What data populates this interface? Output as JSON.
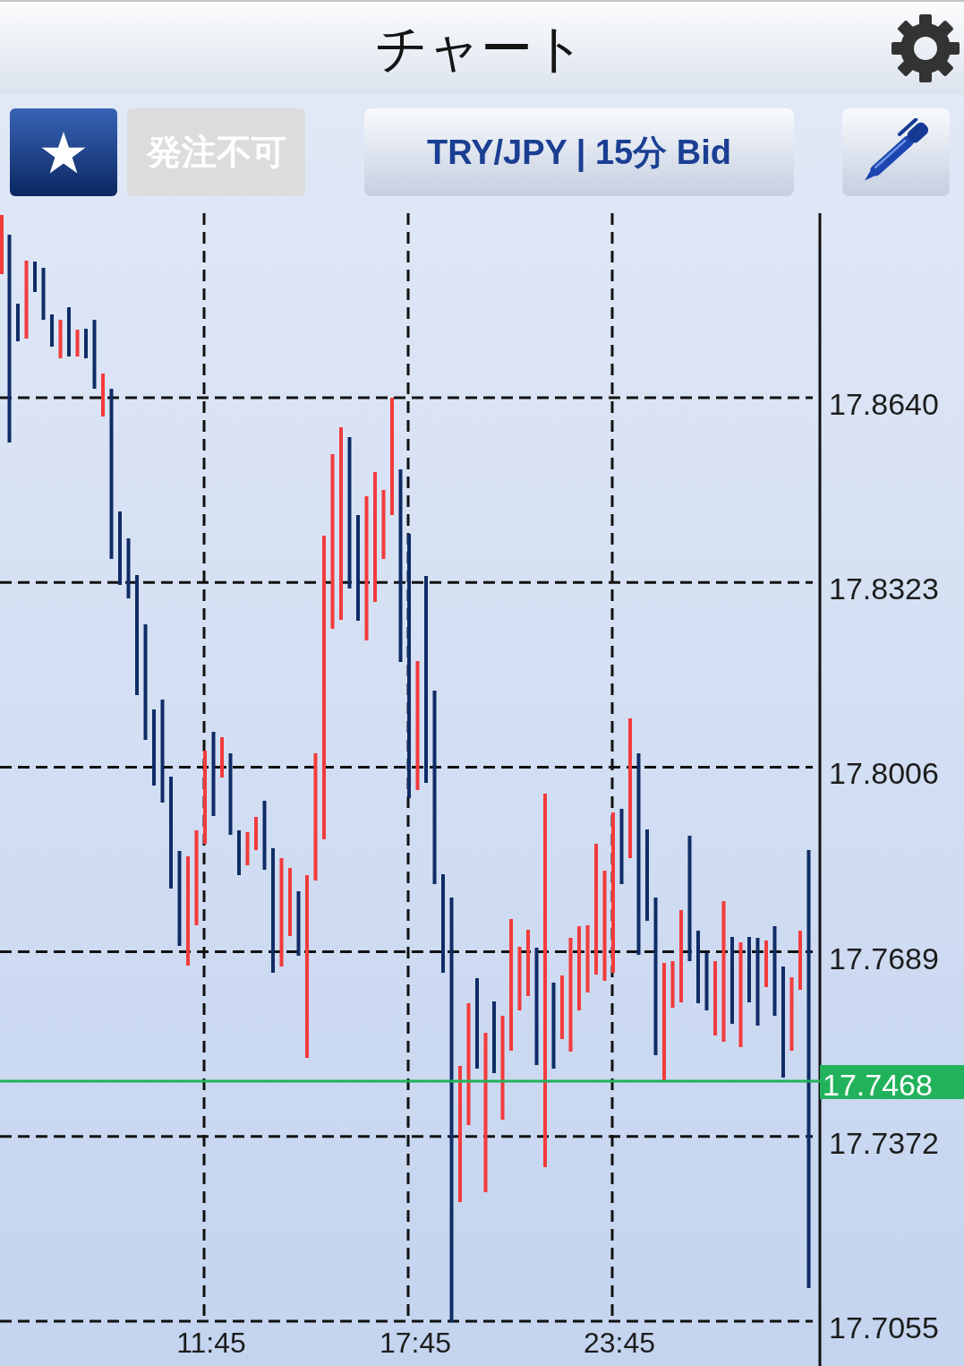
{
  "header": {
    "title": "チャート"
  },
  "toolbar": {
    "order_button": {
      "label": "発注不可",
      "disabled": true
    },
    "symbol_button": {
      "label": "TRY/JPY | 15分 Bid"
    }
  },
  "chart": {
    "price_labels": [
      "17.8640",
      "17.8323",
      "17.8006",
      "17.7689",
      "17.7372",
      "17.7055"
    ],
    "time_labels": [
      "11:45",
      "17:45",
      "23:45"
    ],
    "current_price": {
      "label": "17.7468"
    }
  }
}
